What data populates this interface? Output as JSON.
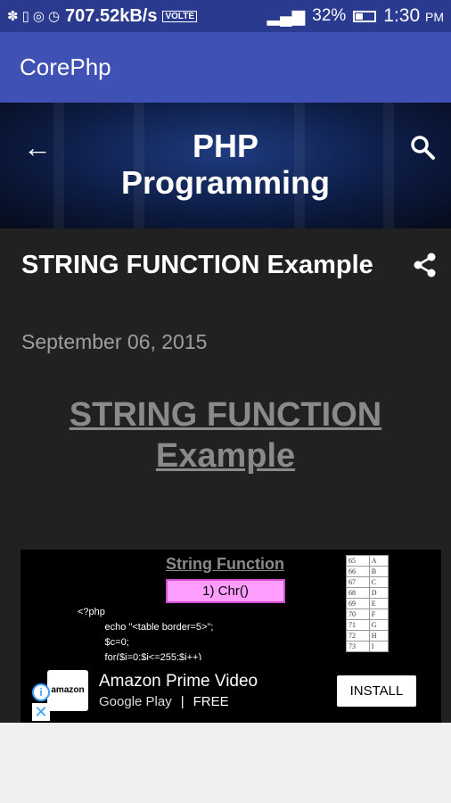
{
  "status_bar": {
    "speed": "707.52kB/s",
    "volte": "VOLTE",
    "battery": "32%",
    "time": "1:30",
    "ampm": "PM"
  },
  "app_bar": {
    "title": "CorePhp"
  },
  "header": {
    "title_line1": "PHP",
    "title_line2": "Programming"
  },
  "post": {
    "title": "STRING FUNCTION Example",
    "date": "September 06, 2015",
    "heading_line1": "STRING FUNCTION",
    "heading_line2": "Example"
  },
  "code_image": {
    "heading": "String Function",
    "tag": "1) Chr()",
    "code_lines": "<?php\n          echo \"<table border=5>\";\n          $c=0;\n          for($i=0;$i<=255;$i++)",
    "table_rows": [
      [
        "65",
        "A"
      ],
      [
        "66",
        "B"
      ],
      [
        "67",
        "C"
      ],
      [
        "68",
        "D"
      ],
      [
        "69",
        "E"
      ],
      [
        "70",
        "F"
      ],
      [
        "71",
        "G"
      ],
      [
        "72",
        "H"
      ],
      [
        "73",
        "I"
      ]
    ]
  },
  "ad": {
    "app_name": "Amazon Prime Video",
    "store": "Google Play",
    "separator": "|",
    "price": "FREE",
    "install_label": "INSTALL",
    "logo_text": "amazon"
  },
  "colors": {
    "status_bar": "#2a3a8f",
    "app_bar": "#3f51b5",
    "content_bg": "#212121"
  }
}
